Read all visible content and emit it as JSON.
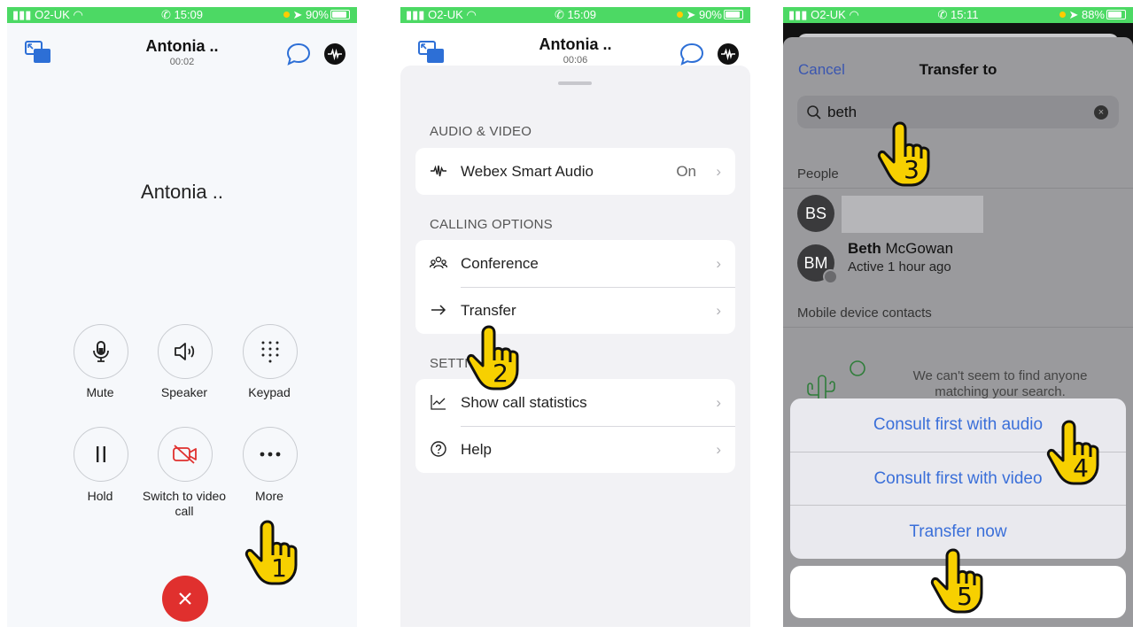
{
  "panel1": {
    "status": {
      "carrier": "O2-UK",
      "time": "15:09",
      "battery": "90%"
    },
    "header": {
      "name": "Antonia ..",
      "duration": "00:02"
    },
    "caller_name": "Antonia ..",
    "controls": {
      "mute": "Mute",
      "speaker": "Speaker",
      "keypad": "Keypad",
      "hold": "Hold",
      "switch_video": "Switch to video call",
      "more": "More"
    },
    "step": "1"
  },
  "panel2": {
    "status": {
      "carrier": "O2-UK",
      "time": "15:09",
      "battery": "90%"
    },
    "header": {
      "name": "Antonia ..",
      "duration": "00:06"
    },
    "sections": {
      "audio_video": "AUDIO & VIDEO",
      "calling_options": "CALLING OPTIONS",
      "settings": "SETTI"
    },
    "rows": {
      "smart_audio": {
        "label": "Webex Smart Audio",
        "value": "On"
      },
      "conference": "Conference",
      "transfer": "Transfer",
      "call_stats": "Show call statistics",
      "help": "Help"
    },
    "step": "2"
  },
  "panel3": {
    "status": {
      "carrier": "O2-UK",
      "time": "15:11",
      "battery": "88%"
    },
    "cancel": "Cancel",
    "title": "Transfer to",
    "search_query": "beth",
    "people_header": "People",
    "people": [
      {
        "initials": "BS"
      },
      {
        "initials": "BM",
        "first": "Beth",
        "last": " McGowan",
        "status": "Active 1 hour ago"
      }
    ],
    "mobile_header": "Mobile device contacts",
    "empty_message": "We can't seem to find anyone matching your search.",
    "actions": {
      "consult_audio": "Consult first with audio",
      "consult_video": "Consult first with video",
      "transfer_now": "Transfer now",
      "cancel_partial": "C"
    },
    "steps": {
      "search": "3",
      "audio": "4",
      "transfer": "5"
    }
  },
  "colors": {
    "accent": "#3a6fd9",
    "status_bar": "#4cd964",
    "end_call": "#e0302e",
    "pointer": "#f7d000"
  }
}
